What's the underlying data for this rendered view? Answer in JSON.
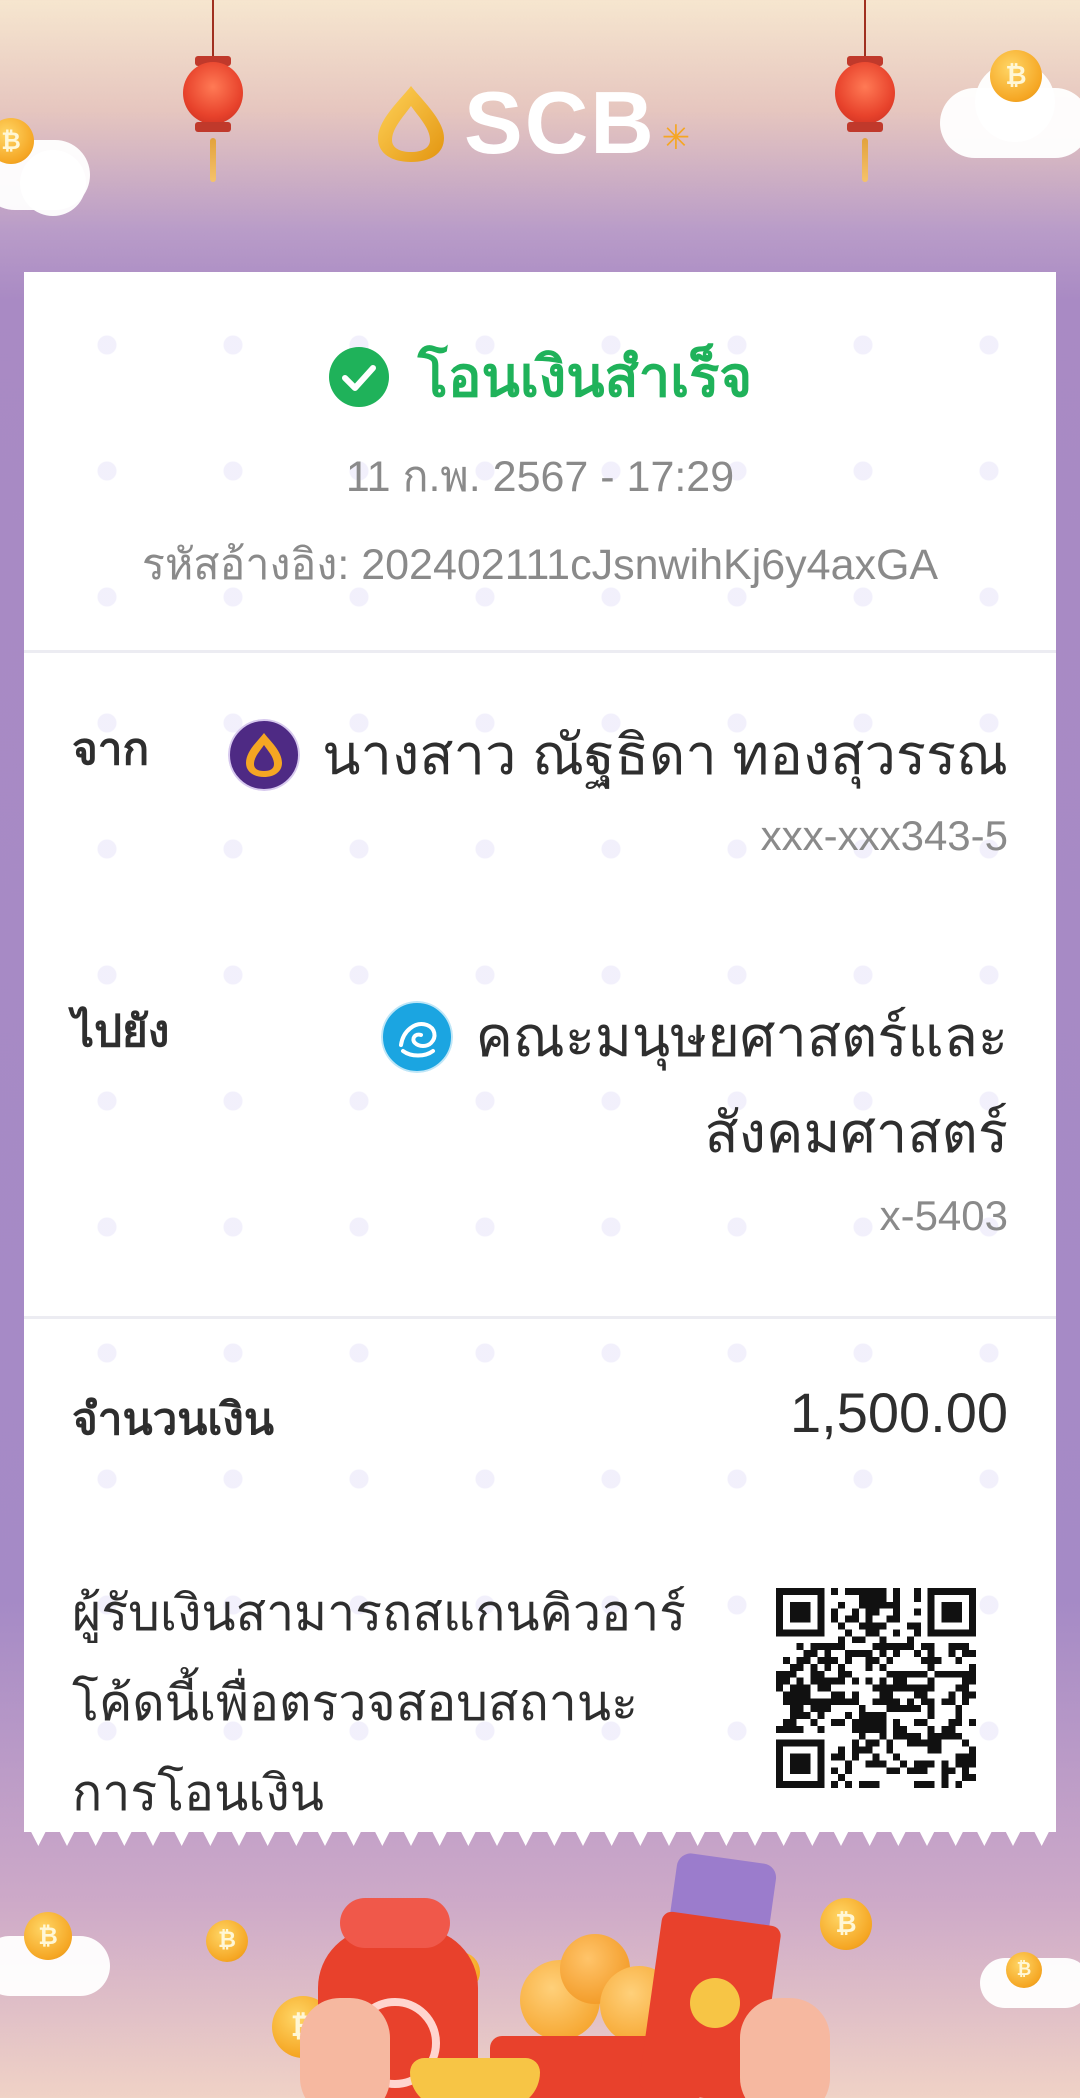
{
  "brand": {
    "name": "SCB",
    "mark_color": "#f5a623"
  },
  "status": {
    "text": "โอนเงินสำเร็จ",
    "color": "#1fb25a",
    "icon": "check-circle-icon"
  },
  "transaction": {
    "datetime": "11 ก.พ. 2567 - 17:29",
    "reference": "รหัสอ้างอิง: 202402111cJsnwihKj6y4axGA"
  },
  "sender": {
    "label": "จาก",
    "name": "นางสาว ณัฐธิดา ทองสุวรรณ",
    "account": "xxx-xxx343-5",
    "bank_icon": "scb-bank-icon",
    "bank_color": "#4e2a84"
  },
  "recipient": {
    "label": "ไปยัง",
    "name_line1": "คณะมนุษยศาสตร์และ",
    "name_line2": "สังคมศาสตร์",
    "account": "x-5403",
    "bank_icon": "ktb-bank-icon",
    "bank_color": "#1ba5e1"
  },
  "amount": {
    "label": "จำนวนเงิน",
    "value": "1,500.00"
  },
  "qr": {
    "note": "ผู้รับเงินสามารถสแกนคิวอาร์โค้ดนี้เพื่อตรวจสอบสถานะการโอนเงิน",
    "icon": "qr-code-icon"
  }
}
